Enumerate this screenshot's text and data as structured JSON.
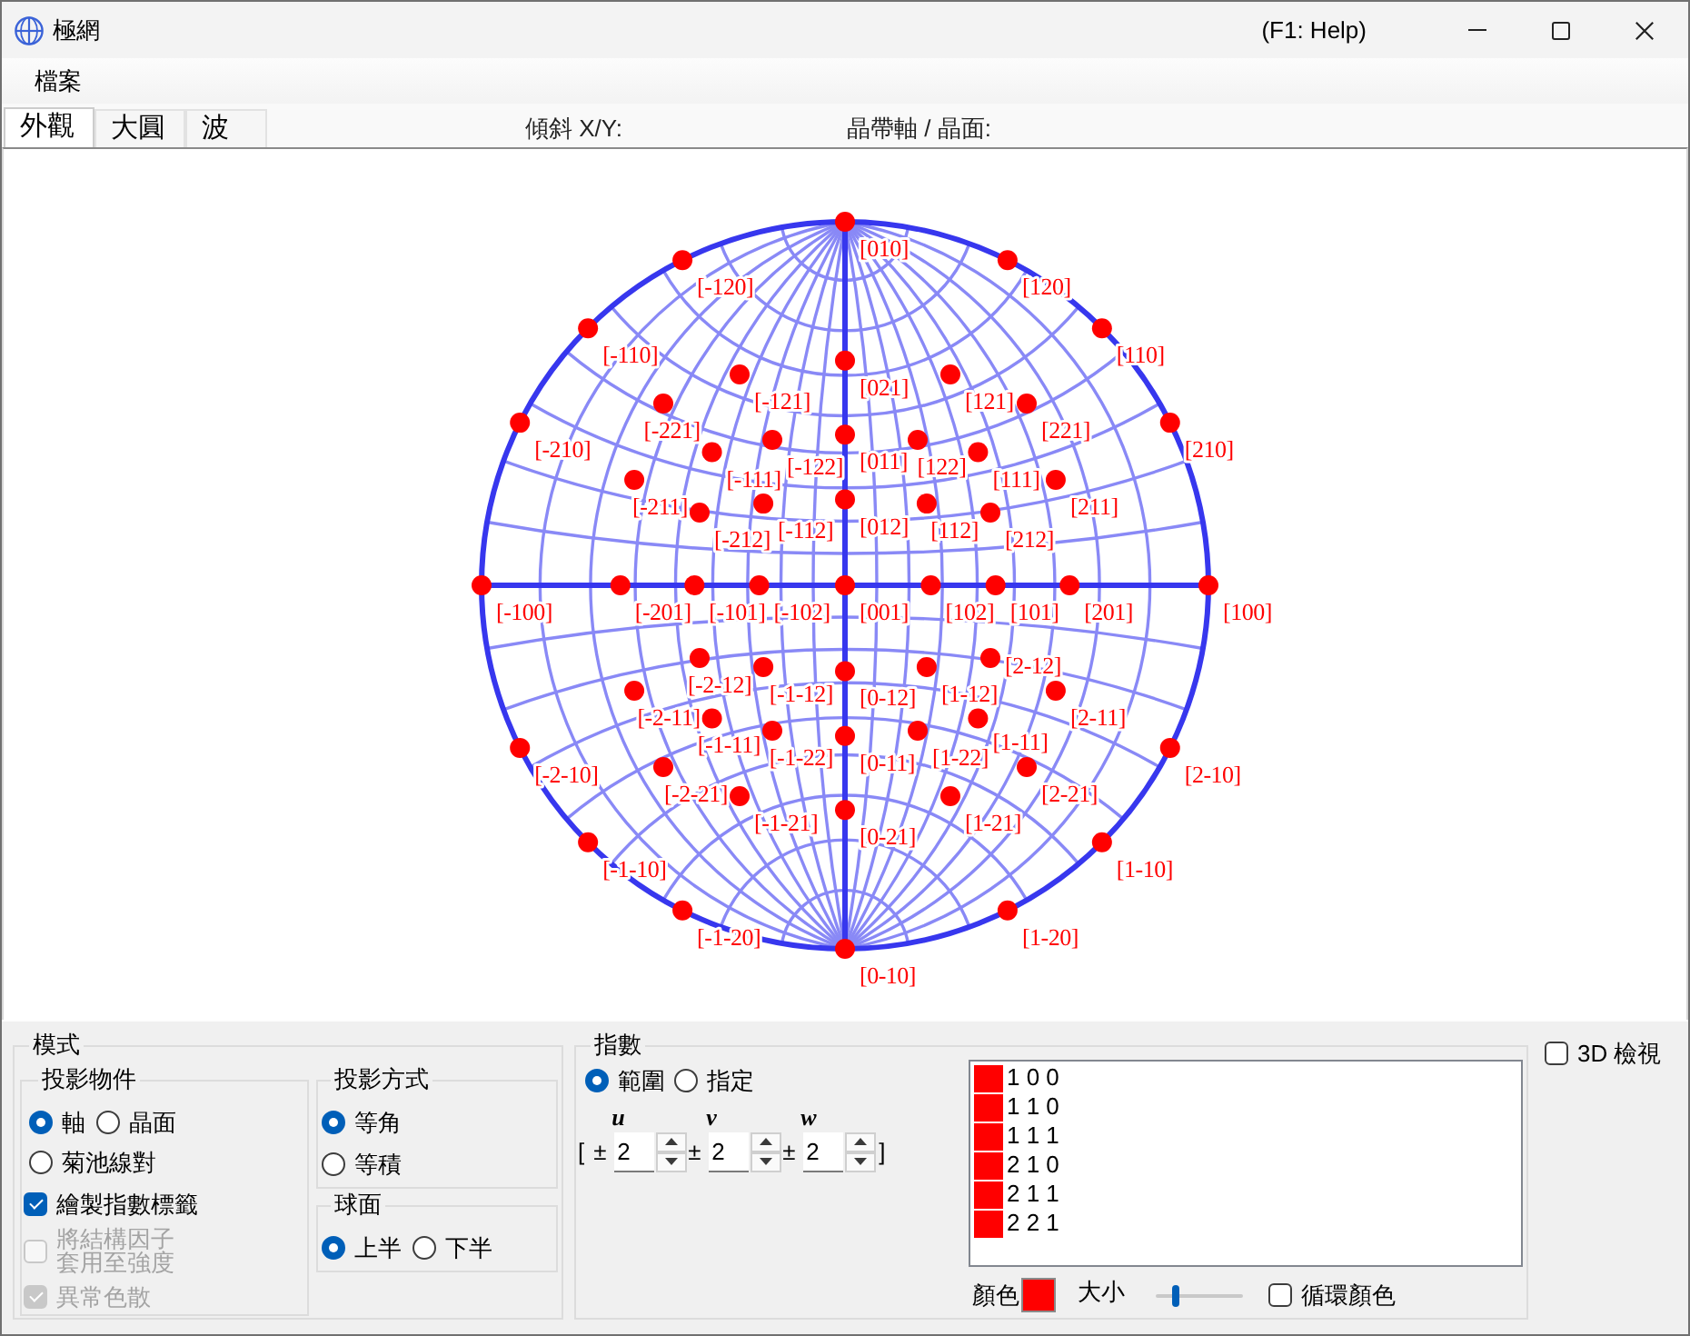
{
  "window": {
    "title": "極網",
    "help_hint": "(F1: Help)"
  },
  "menu": [
    {
      "label": "檔案"
    }
  ],
  "tabs": [
    {
      "label": "外觀",
      "selected": true
    },
    {
      "label": "大圓",
      "selected": false
    },
    {
      "label": "波",
      "selected": false
    }
  ],
  "readouts": [
    {
      "label": "傾斜 X/Y:"
    },
    {
      "label": "晶帶軸 / 晶面:"
    }
  ],
  "projection": {
    "poles": [
      {
        "label": "[010]"
      },
      {
        "label": "[-120]"
      },
      {
        "label": "[120]"
      },
      {
        "label": "[-110]"
      },
      {
        "label": "[110]"
      },
      {
        "label": "[021]"
      },
      {
        "label": "[-121]"
      },
      {
        "label": "[121]"
      },
      {
        "label": "[-221]"
      },
      {
        "label": "[221]"
      },
      {
        "label": "[-210]"
      },
      {
        "label": "[210]"
      },
      {
        "label": "[-122]"
      },
      {
        "label": "[011]"
      },
      {
        "label": "[122]"
      },
      {
        "label": "[-111]"
      },
      {
        "label": "[111]"
      },
      {
        "label": "[-211]"
      },
      {
        "label": "[211]"
      },
      {
        "label": "[-212]"
      },
      {
        "label": "[-112]"
      },
      {
        "label": "[012]"
      },
      {
        "label": "[112]"
      },
      {
        "label": "[212]"
      },
      {
        "label": "[-100]"
      },
      {
        "label": "[-201]"
      },
      {
        "label": "[-101]"
      },
      {
        "label": "[-102]"
      },
      {
        "label": "[001]"
      },
      {
        "label": "[102]"
      },
      {
        "label": "[101]"
      },
      {
        "label": "[201]"
      },
      {
        "label": "[100]"
      },
      {
        "label": "[-2-12]"
      },
      {
        "label": "[-1-12]"
      },
      {
        "label": "[0-12]"
      },
      {
        "label": "[1-12]"
      },
      {
        "label": "[2-12]"
      },
      {
        "label": "[-2-11]"
      },
      {
        "label": "[2-11]"
      },
      {
        "label": "[-1-11]"
      },
      {
        "label": "[1-11]"
      },
      {
        "label": "[-1-22]"
      },
      {
        "label": "[0-11]"
      },
      {
        "label": "[1-22]"
      },
      {
        "label": "[-2-10]"
      },
      {
        "label": "[2-10]"
      },
      {
        "label": "[-2-21]"
      },
      {
        "label": "[2-21]"
      },
      {
        "label": "[-1-21]"
      },
      {
        "label": "[1-21]"
      },
      {
        "label": "[0-21]"
      },
      {
        "label": "[-1-10]"
      },
      {
        "label": "[1-10]"
      },
      {
        "label": "[-1-20]"
      },
      {
        "label": "[1-20]"
      },
      {
        "label": "[0-10]"
      }
    ]
  },
  "mode": {
    "title": "模式",
    "projection_object": {
      "title": "投影物件",
      "options": [
        {
          "label": "軸",
          "selected": true
        },
        {
          "label": "晶面",
          "selected": false
        },
        {
          "label": "菊池線對",
          "selected": false
        }
      ],
      "checkboxes": [
        {
          "lines": [
            "繪製指數標籤"
          ],
          "checked": true,
          "disabled": false
        },
        {
          "lines": [
            "將結構因子",
            "套用至強度"
          ],
          "checked": false,
          "disabled": true
        },
        {
          "lines": [
            "異常色散"
          ],
          "checked": true,
          "disabled": true
        }
      ]
    },
    "projection_method": {
      "title": "投影方式",
      "options": [
        {
          "label": "等角",
          "selected": true
        },
        {
          "label": "等積",
          "selected": false
        }
      ]
    },
    "hemisphere": {
      "title": "球面",
      "options": [
        {
          "label": "上半",
          "selected": true
        },
        {
          "label": "下半",
          "selected": false
        }
      ]
    }
  },
  "indices": {
    "title": "指數",
    "modes": [
      {
        "label": "範圍",
        "selected": true
      },
      {
        "label": "指定",
        "selected": false
      }
    ],
    "open_bracket": "[",
    "close_bracket": "]",
    "spinners": [
      {
        "label": "u",
        "sign": "±",
        "value": "2"
      },
      {
        "label": "v",
        "sign": "±",
        "value": "2"
      },
      {
        "label": "w",
        "sign": "±",
        "value": "2"
      }
    ],
    "families": [
      {
        "label": "1 0 0",
        "color": "#ff0000"
      },
      {
        "label": "1 1 0",
        "color": "#ff0000"
      },
      {
        "label": "1 1 1",
        "color": "#ff0000"
      },
      {
        "label": "2 1 0",
        "color": "#ff0000"
      },
      {
        "label": "2 1 1",
        "color": "#ff0000"
      },
      {
        "label": "2 2 1",
        "color": "#ff0000"
      }
    ],
    "color_label": "顏色",
    "size_label": "大小",
    "size_slider": {
      "level": 0.2
    },
    "cycle_colors": {
      "label": "循環顏色",
      "checked": false
    }
  },
  "view_3d": {
    "label": "3D 檢視",
    "checked": false
  }
}
